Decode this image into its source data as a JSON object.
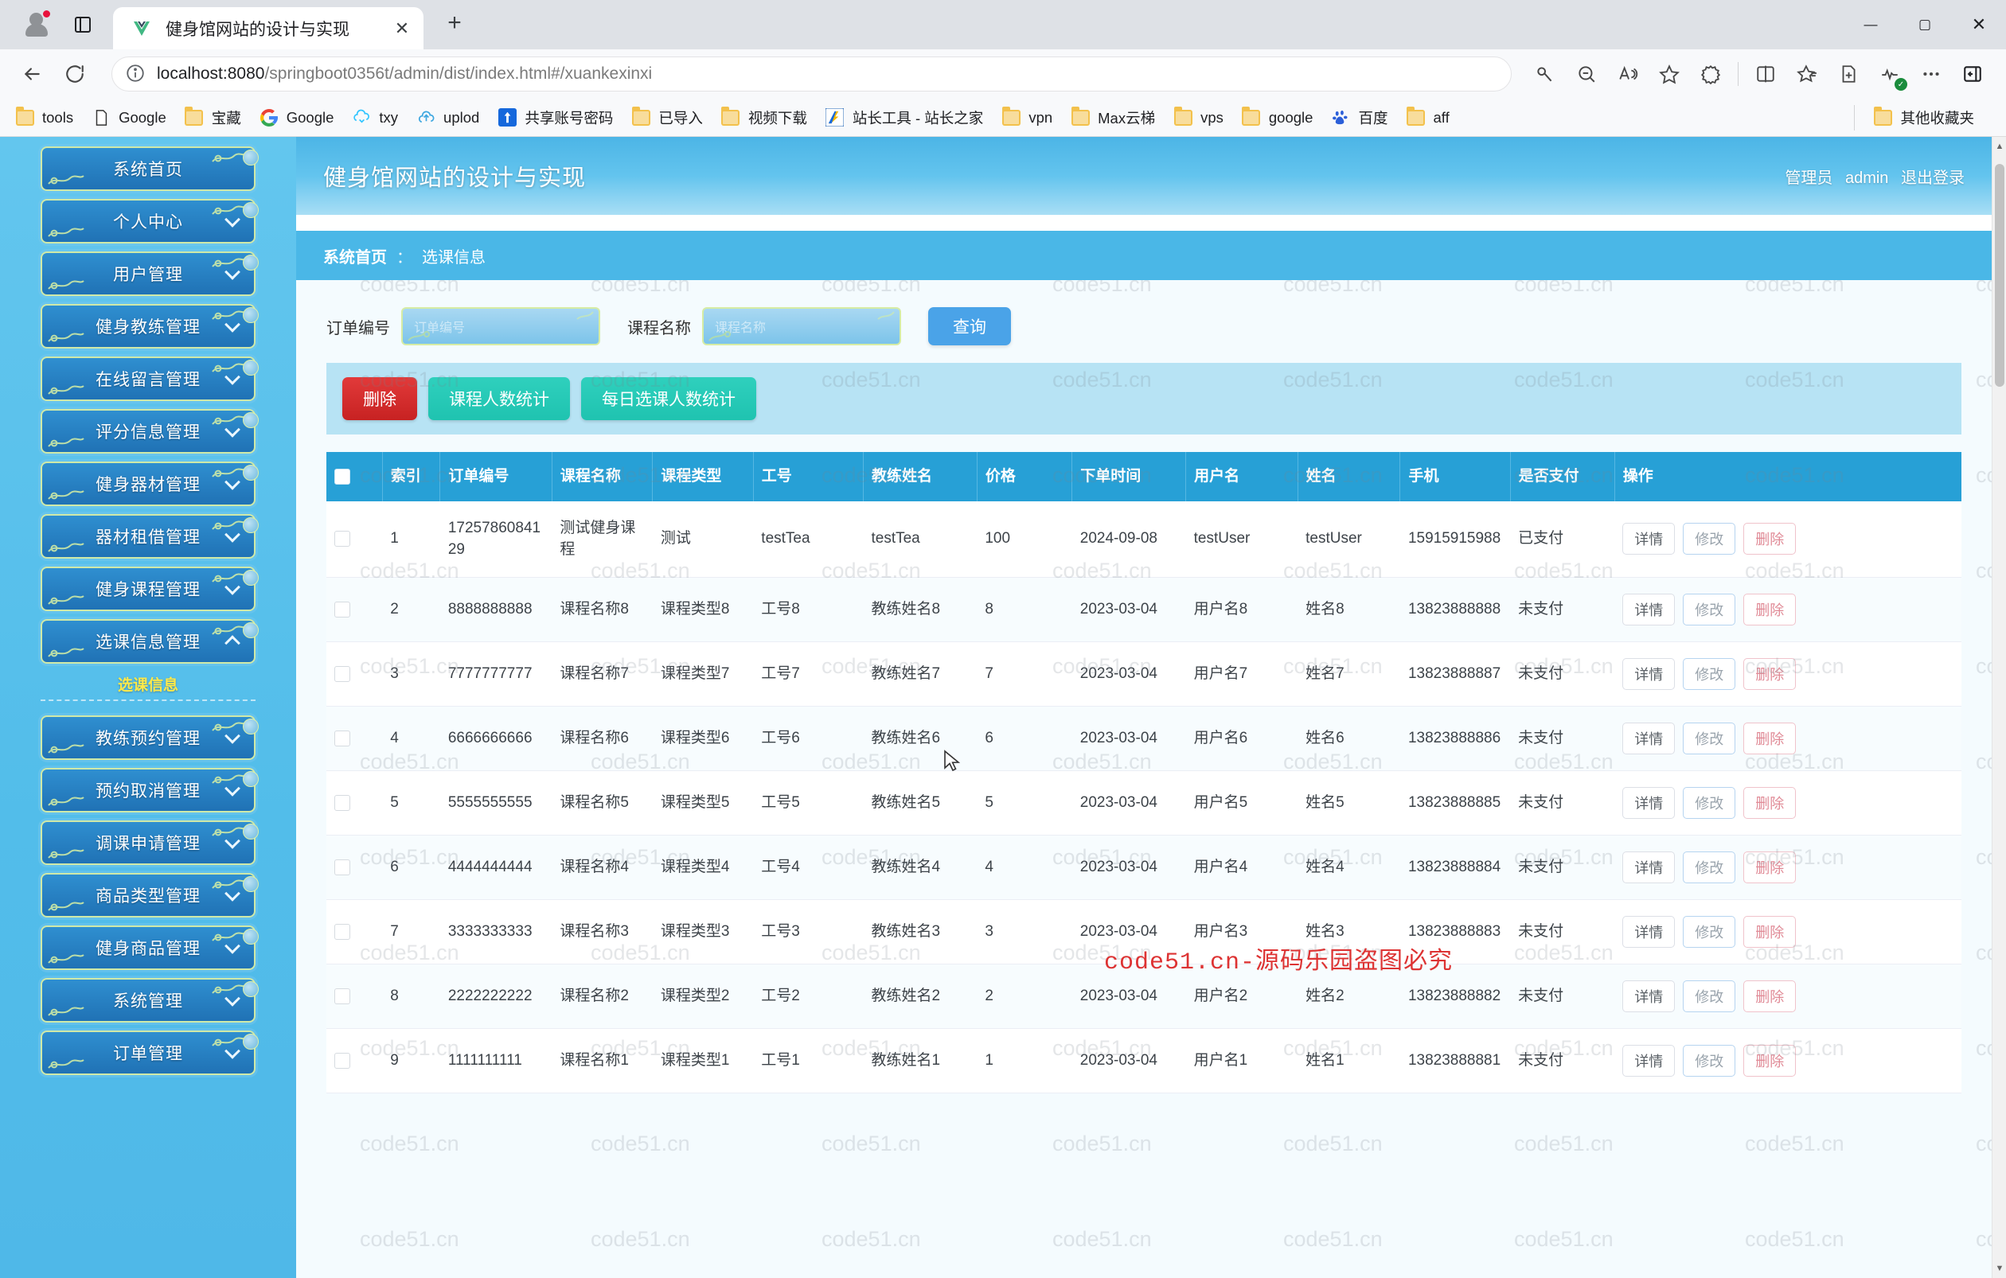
{
  "browser": {
    "tab": {
      "title": "健身馆网站的设计与实现",
      "favicon": "vue-logo-icon",
      "close_label": "✕"
    },
    "new_tab_label": "+",
    "window_controls": {
      "minimize": "—",
      "maximize": "▢",
      "close": "✕"
    },
    "url": {
      "host": "localhost:8080",
      "path": "/springboot0356t/admin/dist/index.html#/xuankexinxi"
    },
    "bookmarks": [
      {
        "label": "tools",
        "icon": "folder-icon"
      },
      {
        "label": "Google",
        "icon": "page-icon"
      },
      {
        "label": "宝藏",
        "icon": "folder-icon"
      },
      {
        "label": "Google",
        "icon": "google-icon"
      },
      {
        "label": "txy",
        "icon": "tencent-cloud-icon"
      },
      {
        "label": "uplod",
        "icon": "upload-cloud-icon"
      },
      {
        "label": "共享账号密码",
        "icon": "share-icon"
      },
      {
        "label": "已导入",
        "icon": "folder-icon"
      },
      {
        "label": "视频下载",
        "icon": "folder-icon"
      },
      {
        "label": "站长工具 - 站长之家",
        "icon": "chinaz-icon"
      },
      {
        "label": "vpn",
        "icon": "folder-icon"
      },
      {
        "label": "Max云梯",
        "icon": "folder-icon"
      },
      {
        "label": "vps",
        "icon": "folder-icon"
      },
      {
        "label": "google",
        "icon": "folder-icon"
      },
      {
        "label": "百度",
        "icon": "baidu-icon"
      },
      {
        "label": "aff",
        "icon": "folder-icon"
      }
    ],
    "other_bookmarks": {
      "label": "其他收藏夹",
      "icon": "folder-icon"
    }
  },
  "app": {
    "title": "健身馆网站的设计与实现",
    "user_role": "管理员",
    "user_name": "admin",
    "logout": "退出登录",
    "breadcrumb": {
      "home": "系统首页",
      "sep": "：",
      "current": "选课信息"
    }
  },
  "sidebar": {
    "items": [
      {
        "label": "系统首页",
        "caret": "none"
      },
      {
        "label": "个人中心",
        "caret": "down"
      },
      {
        "label": "用户管理",
        "caret": "down"
      },
      {
        "label": "健身教练管理",
        "caret": "down"
      },
      {
        "label": "在线留言管理",
        "caret": "down"
      },
      {
        "label": "评分信息管理",
        "caret": "down"
      },
      {
        "label": "健身器材管理",
        "caret": "down"
      },
      {
        "label": "器材租借管理",
        "caret": "down"
      },
      {
        "label": "健身课程管理",
        "caret": "down"
      },
      {
        "label": "选课信息管理",
        "caret": "up"
      }
    ],
    "submenu": {
      "title": "选课信息"
    },
    "items_after": [
      {
        "label": "教练预约管理",
        "caret": "down"
      },
      {
        "label": "预约取消管理",
        "caret": "down"
      },
      {
        "label": "调课申请管理",
        "caret": "down"
      },
      {
        "label": "商品类型管理",
        "caret": "down"
      },
      {
        "label": "健身商品管理",
        "caret": "down"
      },
      {
        "label": "系统管理",
        "caret": "down"
      },
      {
        "label": "订单管理",
        "caret": "down"
      }
    ]
  },
  "search": {
    "order_no_label": "订单编号",
    "order_no_value": "",
    "order_no_placeholder": "订单编号",
    "course_name_label": "课程名称",
    "course_name_value": "",
    "course_name_placeholder": "课程名称",
    "query_button": "查询"
  },
  "toolbar": {
    "delete_button": "删除",
    "course_count_button": "课程人数统计",
    "daily_count_button": "每日选课人数统计"
  },
  "table": {
    "columns": [
      "",
      "索引",
      "订单编号",
      "课程名称",
      "课程类型",
      "工号",
      "教练姓名",
      "价格",
      "下单时间",
      "用户名",
      "姓名",
      "手机",
      "是否支付",
      "操作"
    ],
    "row_actions": {
      "detail": "详情",
      "edit": "修改",
      "delete": "删除"
    },
    "rows": [
      {
        "index": "1",
        "order_no": "1725786084129",
        "course_name": "测试健身课程",
        "course_type": "测试",
        "staff_no": "testTea",
        "coach_name": "testTea",
        "price": "100",
        "order_time": "2024-09-08",
        "username": "testUser",
        "name": "testUser",
        "phone": "15915915988",
        "paid": "已支付"
      },
      {
        "index": "2",
        "order_no": "8888888888",
        "course_name": "课程名称8",
        "course_type": "课程类型8",
        "staff_no": "工号8",
        "coach_name": "教练姓名8",
        "price": "8",
        "order_time": "2023-03-04",
        "username": "用户名8",
        "name": "姓名8",
        "phone": "13823888888",
        "paid": "未支付"
      },
      {
        "index": "3",
        "order_no": "7777777777",
        "course_name": "课程名称7",
        "course_type": "课程类型7",
        "staff_no": "工号7",
        "coach_name": "教练姓名7",
        "price": "7",
        "order_time": "2023-03-04",
        "username": "用户名7",
        "name": "姓名7",
        "phone": "13823888887",
        "paid": "未支付"
      },
      {
        "index": "4",
        "order_no": "6666666666",
        "course_name": "课程名称6",
        "course_type": "课程类型6",
        "staff_no": "工号6",
        "coach_name": "教练姓名6",
        "price": "6",
        "order_time": "2023-03-04",
        "username": "用户名6",
        "name": "姓名6",
        "phone": "13823888886",
        "paid": "未支付"
      },
      {
        "index": "5",
        "order_no": "5555555555",
        "course_name": "课程名称5",
        "course_type": "课程类型5",
        "staff_no": "工号5",
        "coach_name": "教练姓名5",
        "price": "5",
        "order_time": "2023-03-04",
        "username": "用户名5",
        "name": "姓名5",
        "phone": "13823888885",
        "paid": "未支付"
      },
      {
        "index": "6",
        "order_no": "4444444444",
        "course_name": "课程名称4",
        "course_type": "课程类型4",
        "staff_no": "工号4",
        "coach_name": "教练姓名4",
        "price": "4",
        "order_time": "2023-03-04",
        "username": "用户名4",
        "name": "姓名4",
        "phone": "13823888884",
        "paid": "未支付"
      },
      {
        "index": "7",
        "order_no": "3333333333",
        "course_name": "课程名称3",
        "course_type": "课程类型3",
        "staff_no": "工号3",
        "coach_name": "教练姓名3",
        "price": "3",
        "order_time": "2023-03-04",
        "username": "用户名3",
        "name": "姓名3",
        "phone": "13823888883",
        "paid": "未支付"
      },
      {
        "index": "8",
        "order_no": "2222222222",
        "course_name": "课程名称2",
        "course_type": "课程类型2",
        "staff_no": "工号2",
        "coach_name": "教练姓名2",
        "price": "2",
        "order_time": "2023-03-04",
        "username": "用户名2",
        "name": "姓名2",
        "phone": "13823888882",
        "paid": "未支付"
      },
      {
        "index": "9",
        "order_no": "1111111111",
        "course_name": "课程名称1",
        "course_type": "课程类型1",
        "staff_no": "工号1",
        "coach_name": "教练姓名1",
        "price": "1",
        "order_time": "2023-03-04",
        "username": "用户名1",
        "name": "姓名1",
        "phone": "13823888881",
        "paid": "未支付"
      }
    ]
  },
  "watermark": {
    "text": "code51.cn",
    "red_text": "code51.cn-源码乐园盗图必究"
  },
  "colors": {
    "header_blue": "#4cb5e6",
    "breadcrumb_blue": "#4ab7e7",
    "table_header": "#27a0d6",
    "danger": "#c72222",
    "teal": "#1fc3b0",
    "sidebar_item": "#2072b5",
    "submenu_yellow": "#ffe94a"
  }
}
